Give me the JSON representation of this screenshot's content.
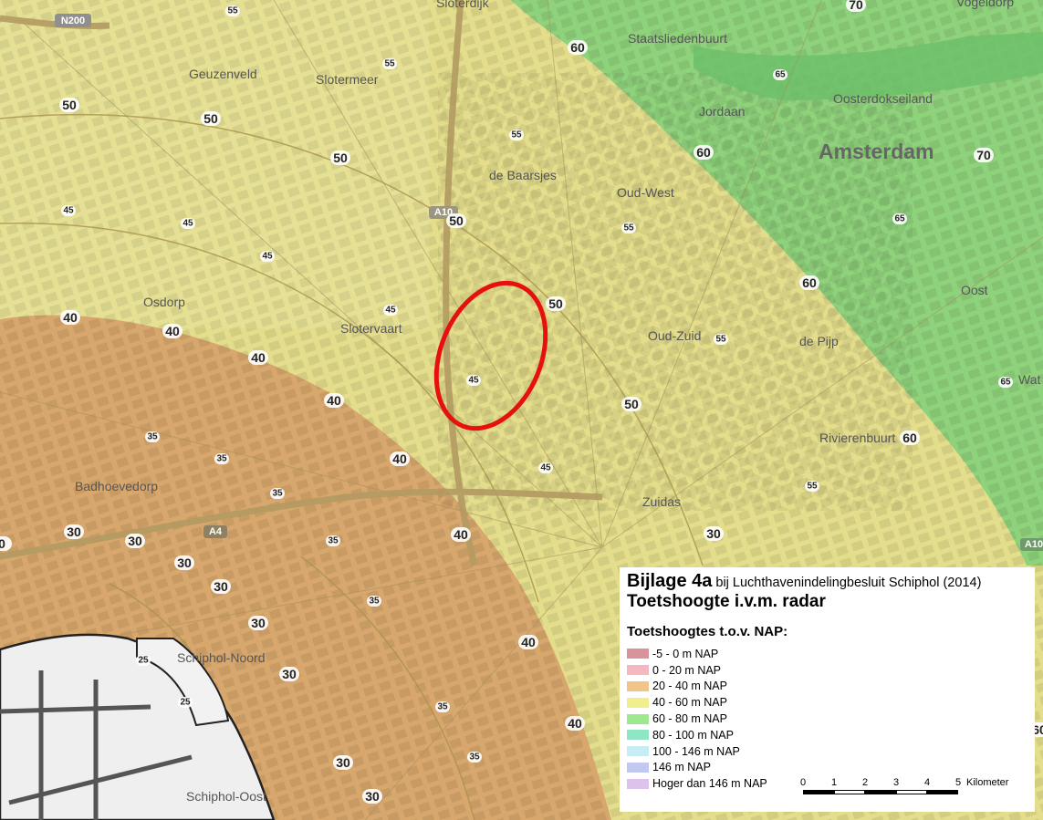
{
  "map": {
    "city_name": "Amsterdam",
    "places": [
      "Sloterdijk",
      "Staatsliedenbuurt",
      "Geuzenveld",
      "Slotermeer",
      "Oosterdokseiland",
      "Jordaan",
      "de Baarsjes",
      "Oud-West",
      "Osdorp",
      "Slotervaart",
      "Oud-Zuid",
      "de Pijp",
      "Oost",
      "Wat",
      "Rivierenbuurt",
      "Badhoevedorp",
      "Zuidas",
      "Schiphol-Noord",
      "Schiphol-Oost",
      "Vogeldorp"
    ],
    "roads": [
      "N200",
      "A10",
      "A4",
      "A10"
    ],
    "height_labels_large": [
      "70",
      "60",
      "50",
      "50",
      "50",
      "50",
      "40",
      "40",
      "40",
      "60",
      "60",
      "70",
      "50",
      "50",
      "40",
      "40",
      "40",
      "30",
      "30",
      "30",
      "30",
      "30",
      "30",
      "40",
      "40",
      "30",
      "30",
      "30",
      "60",
      "60",
      "0"
    ],
    "height_labels_small": [
      "55",
      "55",
      "65",
      "55",
      "45",
      "45",
      "45",
      "55",
      "65",
      "45",
      "45",
      "55",
      "35",
      "35",
      "35",
      "45",
      "55",
      "35",
      "35",
      "35",
      "35",
      "25",
      "25",
      "65"
    ],
    "highlight": "red-ellipse-study-area"
  },
  "legend": {
    "title": "Bijlage 4a",
    "title_suffix": "bij Luchthavenindelingbesluit Schiphol (2014)",
    "subtitle": "Toetshoogte i.v.m. radar",
    "heading": "Toetshoogtes t.o.v. NAP:",
    "items": [
      {
        "label": "-5 - 0 m NAP",
        "color": "#d9939a"
      },
      {
        "label": "0 - 20 m NAP",
        "color": "#f6b8c0"
      },
      {
        "label": "20 - 40 m NAP",
        "color": "#f2c48a"
      },
      {
        "label": "40 - 60 m NAP",
        "color": "#f1ee8e"
      },
      {
        "label": "60 - 80 m NAP",
        "color": "#9ee88d"
      },
      {
        "label": "80 - 100 m NAP",
        "color": "#8fe6c4"
      },
      {
        "label": "100 - 146 m NAP",
        "color": "#c6ecf4"
      },
      {
        "label": "146 m NAP",
        "color": "#c3c8f1"
      },
      {
        "label": "Hoger dan 146 m NAP",
        "color": "#ddc3ec"
      }
    ]
  },
  "scale": {
    "ticks": [
      "0",
      "1",
      "2",
      "3",
      "4",
      "5"
    ],
    "unit": "Kilometer"
  },
  "colors": {
    "zone_20_40": "#d6a56c",
    "zone_40_60": "#e0dc8a",
    "zone_60_80": "#8fd37e",
    "highlight": "#e8100e"
  }
}
